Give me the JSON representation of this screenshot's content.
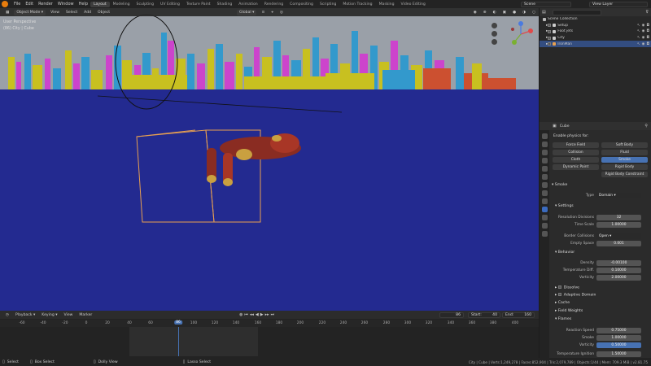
{
  "topbar": {
    "menus": [
      "File",
      "Edit",
      "Render",
      "Window",
      "Help"
    ],
    "workspaces": [
      "Layout",
      "Modeling",
      "Sculpting",
      "UV Editing",
      "Texture Paint",
      "Shading",
      "Animation",
      "Rendering",
      "Compositing",
      "Scripting",
      "Motion Tracking",
      "Masking",
      "Video Editing"
    ],
    "active_workspace": "Layout",
    "scene": "Scene",
    "view_layer": "View Layer"
  },
  "viewport": {
    "mode": "Object Mode",
    "menus": [
      "View",
      "Select",
      "Add",
      "Object"
    ],
    "orientation": "Global",
    "overlay_view": "User Perspective",
    "overlay_object": "(86) City | Cube",
    "background_color": "#232a90",
    "selection_color": "#e8a050"
  },
  "outliner": {
    "root": "Scene Collection",
    "items": [
      {
        "label": "Setup",
        "selected": false
      },
      {
        "label": "Foot jets",
        "selected": false
      },
      {
        "label": "City",
        "selected": false
      },
      {
        "label": "IronMan",
        "selected": true
      }
    ]
  },
  "properties": {
    "object": "Cube",
    "enable_physics_label": "Enable physics for:",
    "physics_buttons": [
      [
        "Force Field",
        "Soft Body"
      ],
      [
        "Collision",
        "Fluid"
      ],
      [
        "Cloth",
        "Smoke"
      ],
      [
        "Dynamic Paint",
        "Rigid Body"
      ],
      [
        "",
        "Rigid Body Constraint"
      ]
    ],
    "smoke_panel": "Smoke",
    "type_label": "Type",
    "type_value": "Domain",
    "settings_panel": "Settings",
    "resolution_label": "Resolution Divisions",
    "resolution_value": "32",
    "time_scale_label": "Time Scale",
    "time_scale_value": "1.00000",
    "border_label": "Border Collisions",
    "border_value": "Open",
    "empty_space_label": "Empty Space",
    "empty_space_value": "0.001",
    "behavior_panel": "Behavior",
    "density_label": "Density",
    "density_value": "-0.00100",
    "temp_diff_label": "Temperature Diff.",
    "temp_diff_value": "0.10000",
    "vorticity_label": "Vorticity",
    "vorticity_value": "2.00000",
    "collapsed_panels": [
      "Dissolve",
      "Adaptive Domain",
      "Cache",
      "Field Weights"
    ],
    "flames_panel": "Flames",
    "reaction_label": "Reaction Speed",
    "reaction_value": "0.75000",
    "smoke_label": "Smoke",
    "smoke_value": "1.00000",
    "flame_vort_label": "Vorticity",
    "flame_vort_value": "0.50000",
    "ignition_label": "Temperature Ignition",
    "ignition_value": "1.50000"
  },
  "timeline": {
    "menus": [
      "Playback",
      "Keying",
      "View",
      "Marker"
    ],
    "current_frame": "86",
    "start_label": "Start:",
    "start_value": "40",
    "end_label": "End:",
    "end_value": "160",
    "ruler_ticks": [
      "-60",
      "-40",
      "-20",
      "0",
      "20",
      "40",
      "60",
      "86",
      "100",
      "120",
      "140",
      "160",
      "180",
      "200",
      "220",
      "240",
      "260",
      "280",
      "300",
      "320",
      "340",
      "360",
      "380",
      "400"
    ]
  },
  "statusbar": {
    "select": "Select",
    "box_select": "Box Select",
    "dolly_view": "Dolly View",
    "lasso_select": "Lasso Select",
    "stats": "City | Cube | Verts:1,249,278 | Faces:852,904 | Tris:2,079,789 | Objects:1/44 | Mem: 709.3 MiB | v2.81.75"
  }
}
